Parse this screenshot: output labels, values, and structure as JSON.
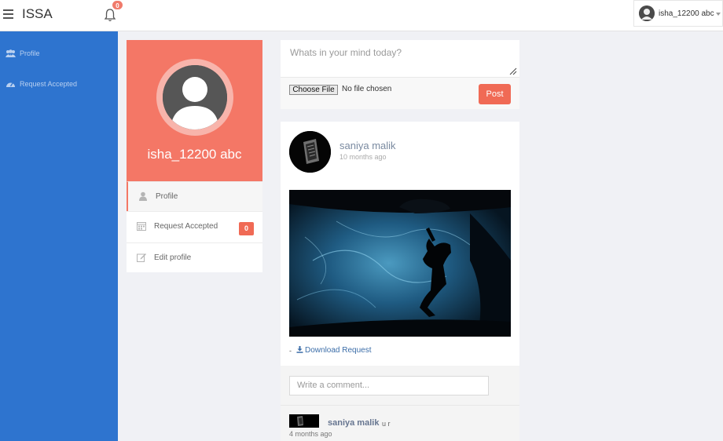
{
  "header": {
    "brand": "ISSA",
    "notification_count": "0",
    "user_name": "isha_12200 abc"
  },
  "sidebar": {
    "items": [
      {
        "label": "Profile",
        "icon": "users-icon"
      },
      {
        "label": "Request Accepted",
        "icon": "dashboard-icon"
      }
    ]
  },
  "profile": {
    "name": "isha_12200 abc",
    "menu": [
      {
        "label": "Profile",
        "icon": "user-icon",
        "active": true
      },
      {
        "label": "Request Accepted",
        "icon": "calendar-icon",
        "badge": "0"
      },
      {
        "label": "Edit profile",
        "icon": "edit-icon"
      }
    ]
  },
  "composer": {
    "placeholder": "Whats in your mind today?",
    "file_button": "Choose File",
    "file_status": "No file chosen",
    "post_button": "Post"
  },
  "post": {
    "author": "saniya malik",
    "time": "10 months ago",
    "download_prefix": "-",
    "download_label": "Download Request"
  },
  "comments": {
    "input_placeholder": "Write a comment...",
    "items": [
      {
        "author": "saniya malik",
        "text": "u r",
        "time": "4 months ago"
      }
    ]
  },
  "colors": {
    "sidebar": "#2e74cf",
    "accent": "#f47766",
    "badge": "#f06a55",
    "link": "#3b6da8"
  }
}
